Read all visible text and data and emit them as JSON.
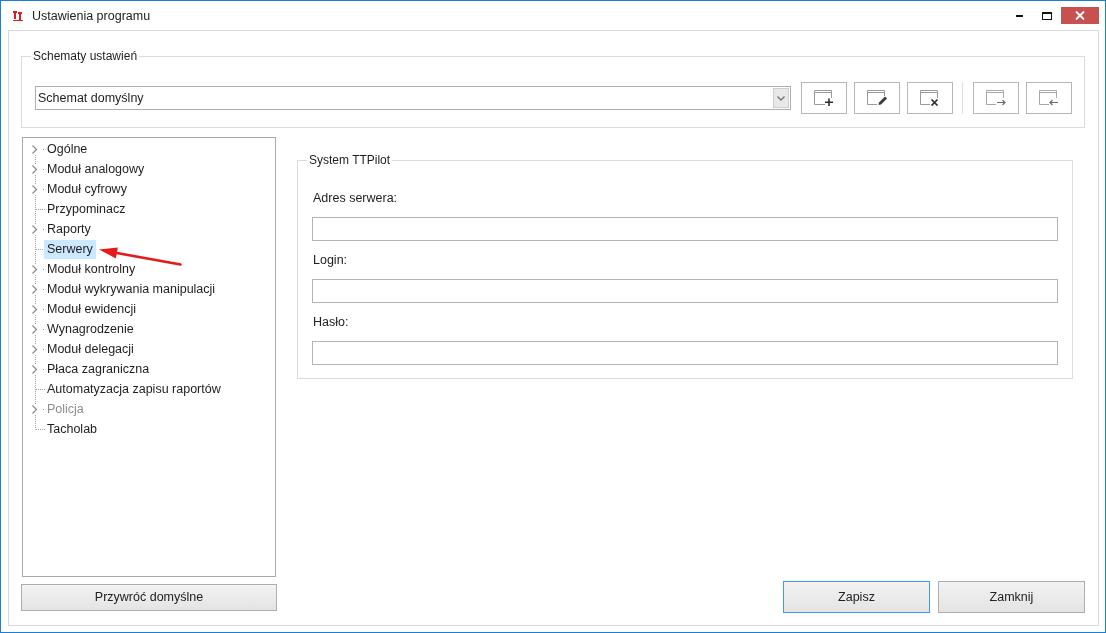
{
  "window": {
    "title": "Ustawienia programu"
  },
  "schemes_group": {
    "legend": "Schematy ustawień",
    "value": "Schemat domyślny"
  },
  "tree": {
    "items": [
      {
        "label": "Ogólne",
        "kind": "branch",
        "selected": false,
        "disabled": false
      },
      {
        "label": "Moduł analogowy",
        "kind": "branch",
        "selected": false,
        "disabled": false
      },
      {
        "label": "Moduł cyfrowy",
        "kind": "branch",
        "selected": false,
        "disabled": false
      },
      {
        "label": "Przypominacz",
        "kind": "leaf",
        "selected": false,
        "disabled": false
      },
      {
        "label": "Raporty",
        "kind": "branch",
        "selected": false,
        "disabled": false
      },
      {
        "label": "Serwery",
        "kind": "leaf",
        "selected": true,
        "disabled": false
      },
      {
        "label": "Moduł kontrolny",
        "kind": "branch",
        "selected": false,
        "disabled": false
      },
      {
        "label": "Moduł wykrywania manipulacji",
        "kind": "branch",
        "selected": false,
        "disabled": false
      },
      {
        "label": "Moduł ewidencji",
        "kind": "branch",
        "selected": false,
        "disabled": false
      },
      {
        "label": "Wynagrodzenie",
        "kind": "branch",
        "selected": false,
        "disabled": false
      },
      {
        "label": "Moduł delegacji",
        "kind": "branch",
        "selected": false,
        "disabled": false
      },
      {
        "label": "Płaca zagraniczna",
        "kind": "branch",
        "selected": false,
        "disabled": false
      },
      {
        "label": "Automatyzacja zapisu raportów",
        "kind": "leaf",
        "selected": false,
        "disabled": false
      },
      {
        "label": "Policja",
        "kind": "branch",
        "selected": false,
        "disabled": true
      },
      {
        "label": "Tacholab",
        "kind": "leaf",
        "selected": false,
        "disabled": false
      }
    ]
  },
  "restore_button": "Przywróć domyślne",
  "server_group": {
    "legend": "System TTPilot",
    "fields": [
      {
        "label": "Adres serwera:"
      },
      {
        "label": "Login:"
      },
      {
        "label": "Hasło:"
      }
    ]
  },
  "buttons": [
    {
      "label": "Zapisz",
      "default": true
    },
    {
      "label": "Zamknij",
      "default": false
    }
  ]
}
